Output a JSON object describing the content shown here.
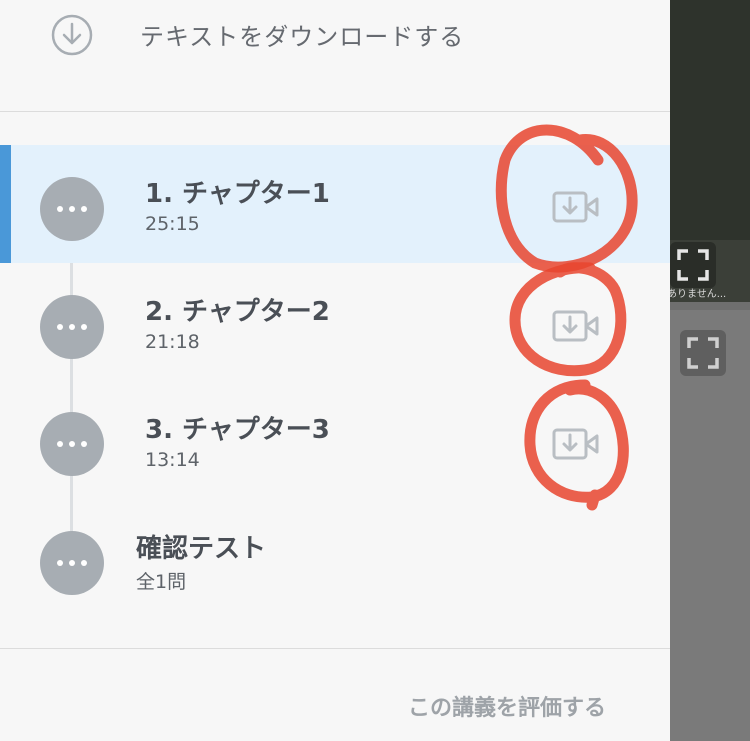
{
  "download": {
    "icon": "download-circle-icon",
    "label": "テキストをダウンロードする"
  },
  "chapters": [
    {
      "title": "1. チャプター1",
      "duration": "25:15",
      "active": true
    },
    {
      "title": "2. チャプター2",
      "duration": "21:18",
      "active": false
    },
    {
      "title": "3. チャプター3",
      "duration": "13:14",
      "active": false
    }
  ],
  "test": {
    "title": "確認テスト",
    "count": "全1問"
  },
  "rate_link": "この講義を評価する",
  "video_caption": "ありません...",
  "colors": {
    "active_bar": "#4a98d8",
    "active_bg": "#e3f1fc",
    "annotation_red": "#e8452f",
    "icon_gray": "#a7adb3"
  },
  "icons": [
    "download-circle-icon",
    "more-dots-icon",
    "video-download-icon",
    "fullscreen-icon"
  ]
}
